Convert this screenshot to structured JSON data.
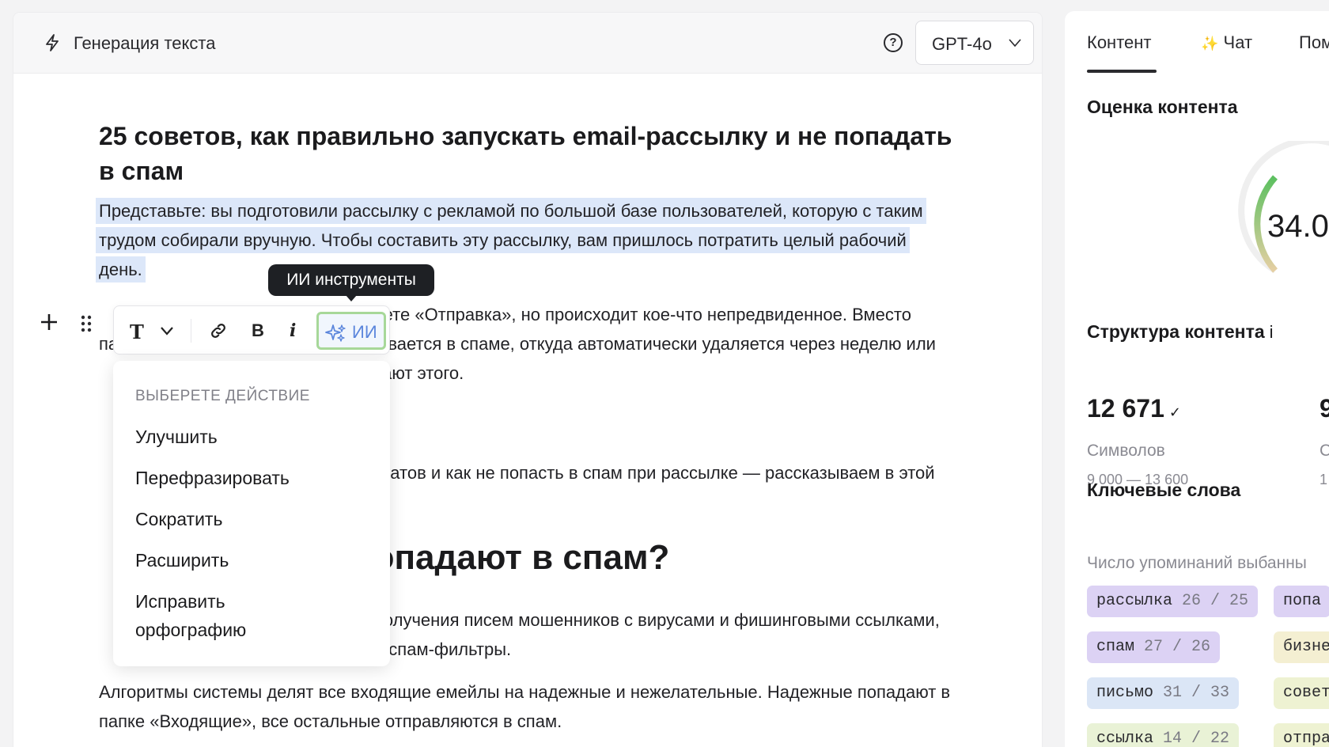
{
  "editor": {
    "header_title": "Генерация текста",
    "model": "GPT-4o",
    "doc_title": "25 советов, как правильно запускать email-рассылку и не попадать в спам",
    "para1_line1": "Представьте: вы подготовили рассылку с рекламой по большой базе пользователей, которую с таким",
    "para1_line2": "трудом собирали вручную. Чтобы составить эту рассылку, вам пришлось потратить целый рабочий",
    "para1_line3": "день.",
    "para2_line1": "имаете «Отправка», но происходит кое-что непредвиденное. Вместо",
    "para2_line2": "папки «Входящие» ваш email оказывается в спаме, откуда автоматически удаляется через неделю или",
    "para2_line3": "мечают этого.",
    "para3": "дресатов и как не попасть в спам при рассылке — рассказываем в этой",
    "h2": "попадают в спам?",
    "para4_line1": "от получения писем мошенников с вирусами и фишинговыми ссылками,",
    "para4_line2": "ные спам-фильтры.",
    "para5_line1": "Алгоритмы системы делят все входящие емейлы на надежные и нежелательные. Надежные попадают в",
    "para5_line2": "папке «Входящие», все остальные отправляются в спам."
  },
  "toolbar": {
    "text_style": "T",
    "bold": "B",
    "italic": "i",
    "ai_label": "ИИ",
    "tooltip": "ИИ инструменты"
  },
  "menu": {
    "header": "ВЫБЕРЕТЕ ДЕЙСТВИЕ",
    "items": [
      "Улучшить",
      "Перефразировать",
      "Сократить",
      "Расширить",
      "Исправить орфографию"
    ]
  },
  "sidebar": {
    "tabs": [
      "Контент",
      "Чат",
      "Пом"
    ],
    "score_title": "Оценка контента",
    "score_value": "34.0",
    "score_fraction": 0.34,
    "structure_title": "Структура контента",
    "structure_info": "i",
    "chars_value": "12 671",
    "chars_label": "Символов",
    "chars_range": "9 000 — 13 600",
    "stat2_value": "9",
    "stat2_label": "С",
    "stat2_range": "1",
    "keywords_title": "Ключевые слова",
    "keywords_subtitle": "Число упоминаний выбанны",
    "keywords": [
      {
        "word": "рассылка",
        "count": "26 / 25",
        "color": "#dcd2f4"
      },
      {
        "word": "попа",
        "count": "",
        "color": "#dcd2f4"
      },
      {
        "word": "спам",
        "count": "27 / 26",
        "color": "#dcd2f4"
      },
      {
        "word": "бизнес",
        "count": "",
        "color": "#f4efd2"
      },
      {
        "word": "письмо",
        "count": "31 / 33",
        "color": "#dbe6f6"
      },
      {
        "word": "совет",
        "count": "",
        "color": "#eef2d2"
      },
      {
        "word": "ссылка",
        "count": "14 / 22",
        "color": "#e9f2d6"
      },
      {
        "word": "отпра",
        "count": "",
        "color": "#eef2d2"
      }
    ]
  },
  "colors": {
    "highlight": "#dce7f9",
    "ai_border": "#a7d899",
    "ai_text": "#5b86dc"
  }
}
